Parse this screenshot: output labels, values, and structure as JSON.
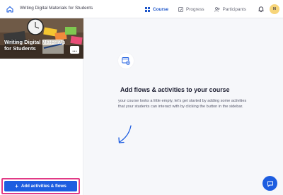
{
  "header": {
    "course_title": "Writing Digital Materials for Students",
    "nav": [
      {
        "label": "Course",
        "icon": "grid-icon",
        "active": true
      },
      {
        "label": "Progress",
        "icon": "progress-icon",
        "active": false
      },
      {
        "label": "Participants",
        "icon": "people-icon",
        "active": false
      }
    ],
    "avatar_initial": "N",
    "accent_color": "#1d55c9"
  },
  "sidebar": {
    "course_card_title": "Writing Digital Materials for Students",
    "card_menu": "...",
    "add_button_label": "Add activities & flows"
  },
  "main": {
    "empty_title": "Add flows & activities to your course",
    "empty_description": "your course looks a little empty, let's get started by adding some activities that your students can interact with by clicking the button in the sidebar."
  },
  "colors": {
    "primary": "#1d5de0",
    "highlight_border": "#e23a86",
    "avatar_bg": "#f7d57a"
  }
}
